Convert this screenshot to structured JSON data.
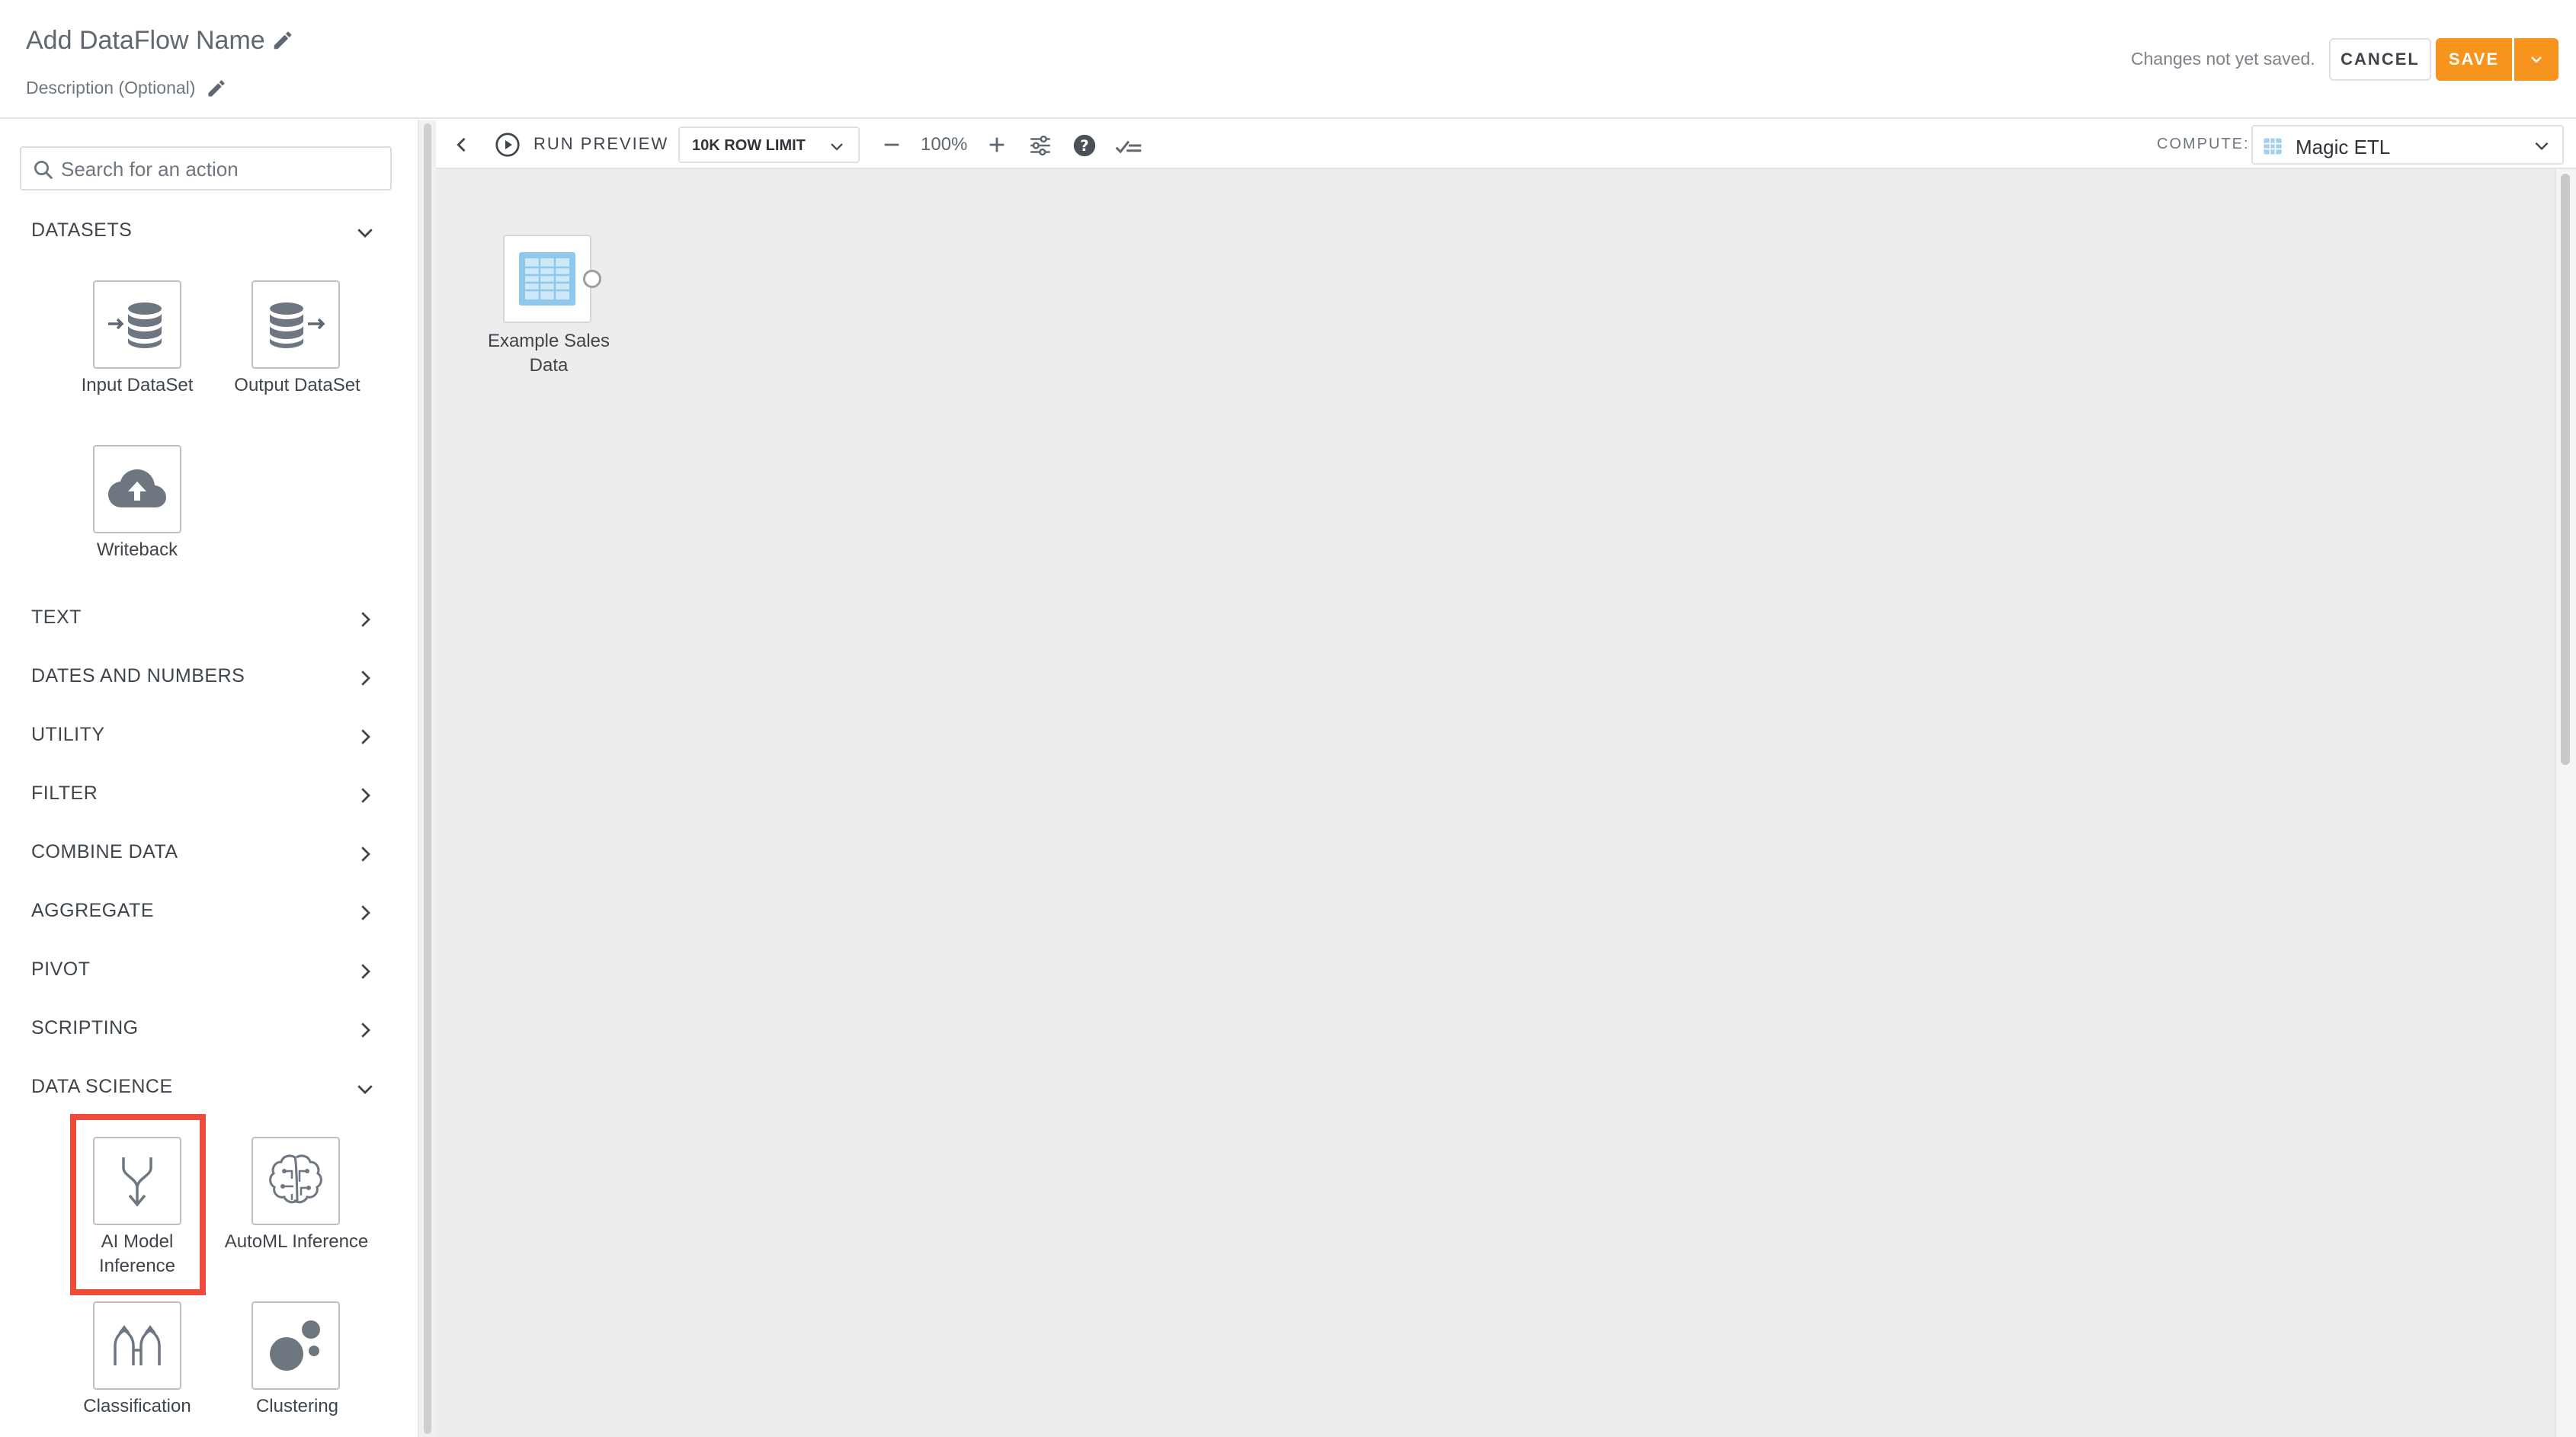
{
  "header": {
    "title": "Add DataFlow Name",
    "description": "Description (Optional)",
    "status": "Changes not yet saved.",
    "cancel_label": "CANCEL",
    "save_label": "SAVE"
  },
  "sidebar": {
    "search_placeholder": "Search for an action",
    "sections": [
      {
        "label": "DATASETS",
        "expanded": true
      },
      {
        "label": "TEXT",
        "expanded": false
      },
      {
        "label": "DATES AND NUMBERS",
        "expanded": false
      },
      {
        "label": "UTILITY",
        "expanded": false
      },
      {
        "label": "FILTER",
        "expanded": false
      },
      {
        "label": "COMBINE DATA",
        "expanded": false
      },
      {
        "label": "AGGREGATE",
        "expanded": false
      },
      {
        "label": "PIVOT",
        "expanded": false
      },
      {
        "label": "SCRIPTING",
        "expanded": false
      },
      {
        "label": "DATA SCIENCE",
        "expanded": true
      }
    ],
    "dataset_tiles": [
      {
        "label": "Input DataSet",
        "icon": "input-dataset-icon"
      },
      {
        "label": "Output DataSet",
        "icon": "output-dataset-icon"
      },
      {
        "label": "Writeback",
        "icon": "cloud-upload-icon"
      }
    ],
    "data_science_tiles": [
      {
        "label_line1": "AI Model",
        "label_line2": "Inference",
        "icon": "merge-arrow-icon"
      },
      {
        "label": "AutoML Inference",
        "icon": "brain-icon"
      },
      {
        "label": "Classification",
        "icon": "classification-icon"
      },
      {
        "label": "Clustering",
        "icon": "clustering-icon"
      }
    ]
  },
  "toolbar": {
    "run_preview": "RUN PREVIEW",
    "row_limit": "10K ROW LIMIT",
    "zoom": "100%",
    "compute_label": "COMPUTE:",
    "compute_value": "Magic ETL"
  },
  "canvas": {
    "node_label_line1": "Example Sales",
    "node_label_line2": "Data"
  },
  "colors": {
    "accent": "#f7941d",
    "highlight": "#ee4b3d",
    "canvas_bg": "#ededed"
  }
}
